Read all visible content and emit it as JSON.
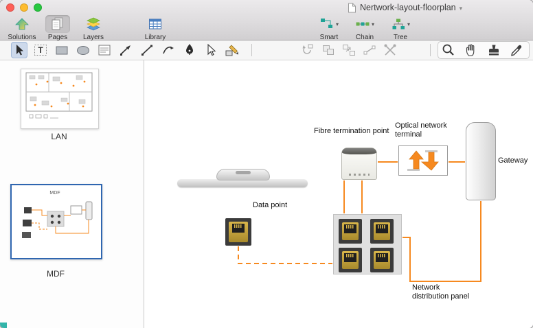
{
  "titlebar": {
    "title": "Nertwork-layout-floorplan"
  },
  "ui": {
    "caret": "▾"
  },
  "toolbar_main": {
    "buttons": [
      {
        "label": "Solutions",
        "icon": "solutions-icon",
        "selected": false
      },
      {
        "label": "Pages",
        "icon": "pages-icon",
        "selected": true
      },
      {
        "label": "Layers",
        "icon": "layers-icon",
        "selected": false
      },
      {
        "label": "Library",
        "icon": "library-icon",
        "selected": false
      },
      {
        "label": "Smart",
        "icon": "smart-diagram-icon",
        "dropdown": true
      },
      {
        "label": "Chain",
        "icon": "chain-diagram-icon",
        "dropdown": true
      },
      {
        "label": "Tree",
        "icon": "tree-diagram-icon",
        "dropdown": true
      }
    ]
  },
  "tool_strip": {
    "selected_tool": "select",
    "tools_left": [
      "select",
      "text",
      "rectangle",
      "ellipse",
      "text-block",
      "connector-arrow",
      "line",
      "arc",
      "pen",
      "direct-select",
      "shape-edit"
    ],
    "tools_middle_disabled": [
      "rotate-shape",
      "combine-shapes",
      "distribute-shapes",
      "edit-nodes",
      "advanced-tools"
    ],
    "tools_right": [
      "zoom",
      "pan-hand",
      "stamp",
      "eyedropper"
    ]
  },
  "sidebar": {
    "pages": [
      {
        "label": "LAN",
        "selected": false
      },
      {
        "label": "MDF",
        "selected": true,
        "thumb_text": "MDF"
      }
    ]
  },
  "canvas": {
    "labels": {
      "data_point": "Data point",
      "fibre_termination_point": "Fibre termination point",
      "optical_line1": "Optical network",
      "optical_line2": "terminal",
      "gateway": "Gateway",
      "panel_line1": "Network",
      "panel_line2": "distribution panel"
    }
  },
  "icons": {
    "text_tool_glyph": "T"
  },
  "colors": {
    "connector_orange": "#F6891F",
    "selection_blue": "#2F66B0",
    "jack_gold": "#C9A441"
  }
}
